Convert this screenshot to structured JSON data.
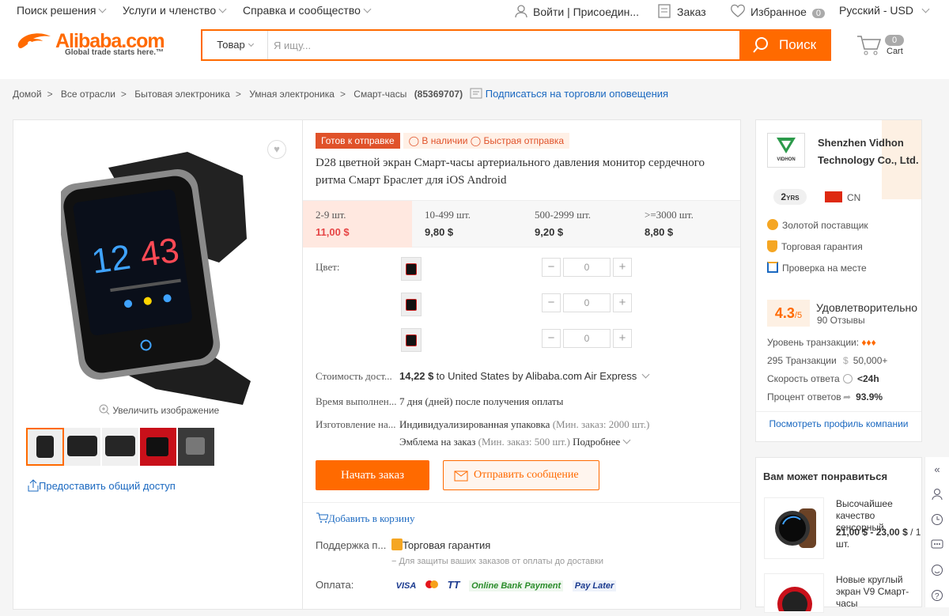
{
  "topbar": {
    "solutions": "Поиск решения",
    "services": "Услуги и членство",
    "help": "Справка и сообщество",
    "signin": "Войти | Присоедин...",
    "orders": "Заказ",
    "favorites": "Избранное",
    "favorites_count": "0",
    "lang": "Русский - USD"
  },
  "logo": {
    "text": "Alibaba.com",
    "tagline": "Global trade starts here.™"
  },
  "search": {
    "category": "Товар",
    "placeholder": "Я ищу...",
    "button": "Поиск"
  },
  "cart": {
    "count": "0",
    "label": "Cart"
  },
  "breadcrumb": {
    "items": [
      "Домой",
      "Все отрасли",
      "Бытовая электроника",
      "Умная электроника",
      "Смарт-часы"
    ],
    "id": "(85369707)",
    "subscribe": "Подписаться на торговли оповещения"
  },
  "gallery": {
    "zoom": "Увеличить изображение",
    "share": "Предоставить общий доступ"
  },
  "product": {
    "tag_ready": "Готов к отправке",
    "tag_stock": "В наличии",
    "tag_fast": "Быстрая отправка",
    "title": "D28 цветной экран Смарт-часы артериального давления монитор сердечного ритма Смарт Браслет для iOS Android"
  },
  "price_tiers": [
    {
      "qty": "2-9 шт.",
      "price": "11,00 $"
    },
    {
      "qty": "10-499 шт.",
      "price": "9,80 $"
    },
    {
      "qty": "500-2999 шт.",
      "price": "9,20 $"
    },
    {
      "qty": ">=3000 шт.",
      "price": "8,80 $"
    }
  ],
  "options": {
    "color_label": "Цвет:",
    "qty_values": [
      "0",
      "0",
      "0"
    ]
  },
  "shipping": {
    "label": "Стоимость дост...",
    "price": "14,22 $",
    "text": "to United States by Alibaba.com Air Express"
  },
  "lead": {
    "label": "Время выполнен...",
    "value": "7 дня (дней) после получения оплаты"
  },
  "custom": {
    "label": "Изготовление на...",
    "line1": "Индивидуализированная упаковка",
    "line1_min": "(Мин. заказ: 2000 шт.)",
    "line2": "Эмблема на заказ",
    "line2_min": "(Мин. заказ: 500 шт.)",
    "more": "Подробнее"
  },
  "actions": {
    "order": "Начать заказ",
    "message": "Отправить сообщение",
    "add_cart": "Добавить в корзину"
  },
  "support": {
    "label": "Поддержка п...",
    "value": "Торговая гарантия",
    "note": "− Для защиты ваших заказов от оплаты до доставки"
  },
  "payment": {
    "label": "Оплата:",
    "methods": [
      "VISA",
      "",
      "TT",
      "Online Bank Payment",
      "Pay Later"
    ]
  },
  "supplier": {
    "name": "Shenzhen Vidhon Technology Co., Ltd.",
    "logo_text": "VIDHON",
    "years": "2",
    "years_unit": "YRS",
    "country": "CN",
    "badges": [
      "Золотой поставщик",
      "Торговая гарантия",
      "Проверка на месте"
    ],
    "rating": "4.3",
    "rating_max": "/5",
    "rating_label": "Удовлетворительно",
    "reviews": "90 Отзывы",
    "level": "Уровень транзакции:",
    "transactions": "295 Транзакции",
    "amount": "50,000+",
    "response_speed_label": "Скорость ответа",
    "response_speed": "<24h",
    "response_rate_label": "Процент ответов",
    "response_rate": "93.9%",
    "profile_link": "Посмотреть профиль компании"
  },
  "recommend": {
    "title": "Вам может понравиться",
    "items": [
      {
        "name": "Высочайшее качество сенсорный",
        "price": "21,00 $ - 23,00 $",
        "unit": "/ 1 шт."
      },
      {
        "name": "Новые круглый экран V9 Смарт-часы"
      }
    ]
  },
  "colors": {
    "accent": "#ff6a00",
    "link": "#1a68c0",
    "price_red": "#e64545"
  }
}
